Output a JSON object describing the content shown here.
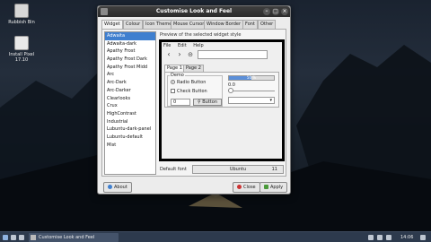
{
  "desktop": {
    "icons": [
      {
        "label": "Rubbish Bin"
      },
      {
        "label": "Install Pixel",
        "label2": "17.10"
      }
    ]
  },
  "window": {
    "title": "Customise Look and Feel",
    "tabs": [
      "Widget",
      "Colour",
      "Icon Theme",
      "Mouse Cursor",
      "Window Border",
      "Font",
      "Other"
    ],
    "active_tab": "Widget",
    "themes": [
      "Adwaita",
      "Adwaita-dark",
      "Apathy Frost",
      "Apathy Frost Dark",
      "Apathy Frost Midd",
      "Arc",
      "Arc-Dark",
      "Arc-Darker",
      "Clearlooks",
      "Crux",
      "HighContrast",
      "Industrial",
      "Lubuntu-dark-panel",
      "Lubuntu-default",
      "Mist"
    ],
    "selected_theme": "Adwaita",
    "preview": {
      "label": "Preview of the selected widget style",
      "menu": [
        "File",
        "Edit",
        "Help"
      ],
      "tabs": [
        "Page 1",
        "Page 2"
      ],
      "group_title": "Demo",
      "radio_label": "Radio Button",
      "check_label": "Check Button",
      "spin_value": "0",
      "button_label": "Button",
      "progress_text": "50 %",
      "progress_value": 0.5,
      "num_value": "0.0"
    },
    "default_font_label": "Default font",
    "font_name": "Ubuntu",
    "font_size": "11",
    "buttons": {
      "about": "About",
      "close": "Close",
      "apply": "Apply"
    }
  },
  "taskbar": {
    "task": "Customise Look and Feel",
    "clock": "14:06"
  },
  "colors": {
    "selection": "#3f7fcf",
    "titlebar": "#2b2b2b",
    "taskbar": "#2d3a4d"
  }
}
